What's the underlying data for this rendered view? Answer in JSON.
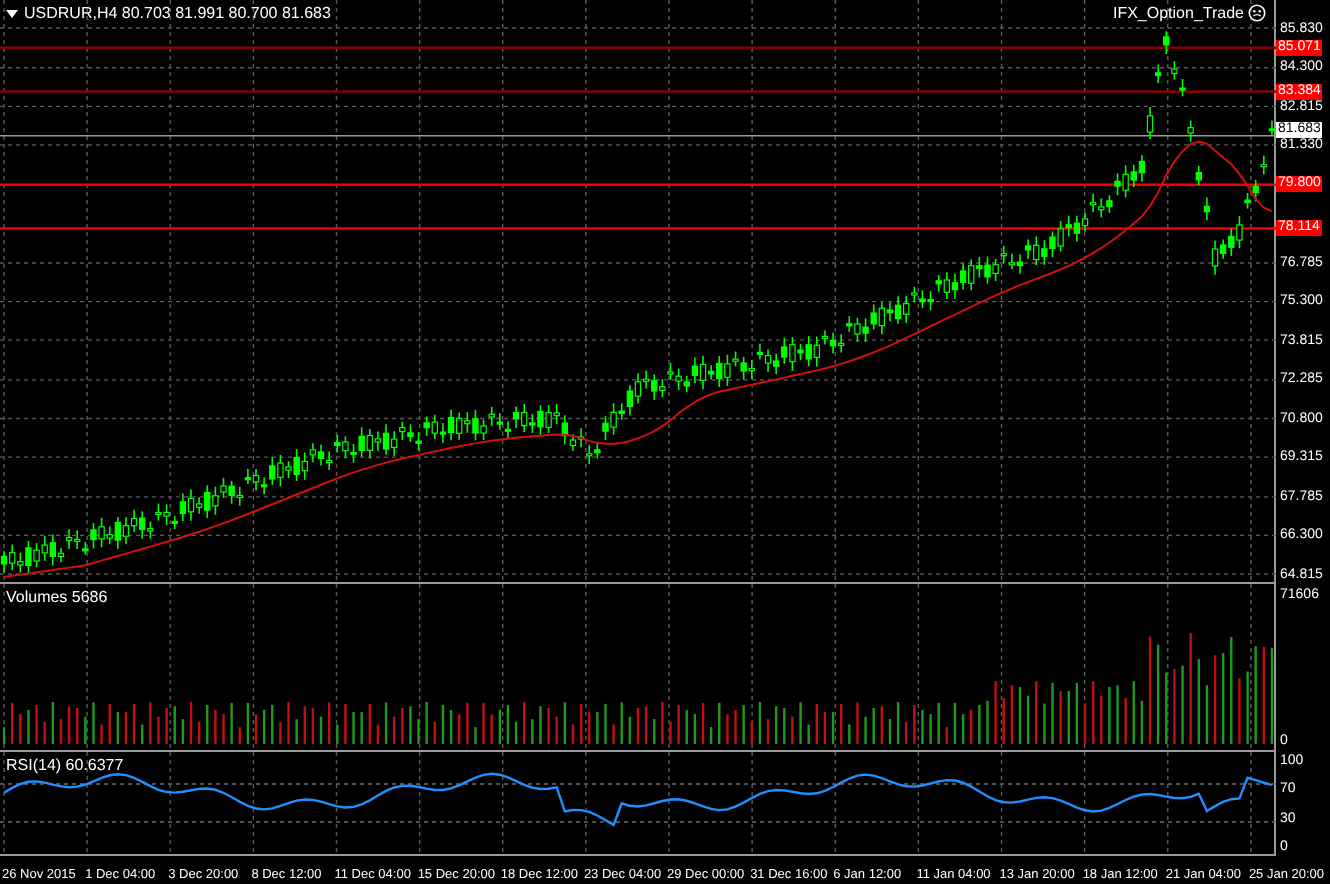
{
  "symbol_header": {
    "text": "USDRUR,H4 80.703 81.991 80.700 81.683"
  },
  "expert": {
    "name": "IFX_Option_Trade"
  },
  "main_pane": {
    "price_ticks": [
      "85.830",
      "84.300",
      "82.815",
      "81.330",
      "76.785",
      "75.300",
      "73.815",
      "72.285",
      "70.800",
      "69.315",
      "67.785",
      "66.300",
      "64.815"
    ],
    "levels": [
      {
        "value": "85.071",
        "color": "#8b0000"
      },
      {
        "value": "83.384",
        "color": "#8b0000"
      },
      {
        "value": "79.800",
        "color": "#ff0000"
      },
      {
        "value": "78.114",
        "color": "#ff0000"
      }
    ],
    "current_price": "81.683"
  },
  "volume_pane": {
    "label": "Volumes 5686",
    "ticks": [
      "71606",
      "0"
    ]
  },
  "rsi_pane": {
    "label": "RSI(14) 60.6377",
    "ticks": [
      "100",
      "70",
      "30",
      "0"
    ]
  },
  "time_axis": [
    "26 Nov 2015",
    "1 Dec 04:00",
    "3 Dec 20:00",
    "8 Dec 12:00",
    "11 Dec 04:00",
    "15 Dec 20:00",
    "18 Dec 12:00",
    "23 Dec 04:00",
    "29 Dec 00:00",
    "31 Dec 16:00",
    "6 Jan 12:00",
    "11 Jan 04:00",
    "13 Jan 20:00",
    "18 Jan 12:00",
    "21 Jan 04:00",
    "25 Jan 20:00"
  ]
}
